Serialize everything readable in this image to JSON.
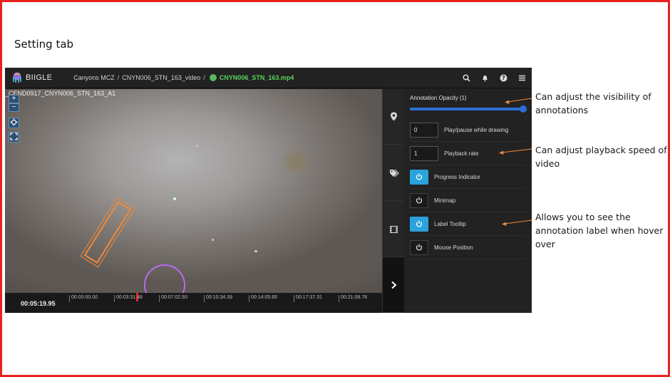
{
  "slide": {
    "heading": "Setting tab",
    "border_color": "#e8231f"
  },
  "navbar": {
    "brand": "BIIGLE",
    "breadcrumb": [
      "Canyons MCZ",
      "CNYN006_STN_163_video"
    ],
    "file_name": "CNYN006_STN_163.mp4",
    "file_status_color": "#5cb85c",
    "icons": [
      "search-icon",
      "bell-icon",
      "help-icon",
      "menu-icon"
    ]
  },
  "video": {
    "label": "_CEND0917_CNYN006_STN_163_A1",
    "map_controls": [
      "+",
      "−"
    ],
    "current_time": "00:05:19.95",
    "timeline_ticks": [
      "00:00:00.00",
      "00:03:31.46",
      "00:07:02.93",
      "00:10:34.39",
      "00:14:05.85",
      "00:17:37.31",
      "00:21:08.78"
    ],
    "annotation_color": "#f08a3c",
    "circle_color": "#b46cf0"
  },
  "toolbar": {
    "groups": [
      [
        "play-icon"
      ],
      [
        "point-icon",
        "polygon-icon",
        "circle-icon",
        "linestring-icon",
        "wholeframe-icon",
        "rectangle-icon"
      ],
      [
        "tag-icon",
        "move-icon",
        "link-icon",
        "unlink-icon",
        "trash-icon"
      ]
    ]
  },
  "sidebar_tabs": [
    "map-marker-icon",
    "tags-icon",
    "film-icon",
    "chevron-right-icon"
  ],
  "settings": {
    "opacity_label": "Annotation Opacity (1)",
    "opacity_value": 1,
    "play_pause_value": "0",
    "play_pause_label": "Play/pause while drawing",
    "playback_rate_value": "1",
    "playback_rate_label": "Playback rate",
    "progress_indicator_label": "Progress Indicator",
    "progress_indicator_on": true,
    "minimap_label": "Minimap",
    "minimap_on": false,
    "label_tooltip_label": "Label Tooltip",
    "label_tooltip_on": true,
    "mouse_position_label": "Mouse Position",
    "mouse_position_on": false,
    "toggle_on_color": "#2aa3dc"
  },
  "callouts": {
    "opacity": "Can adjust the visibility of annotations",
    "playback": "Can adjust playback speed of video",
    "tooltip": "Allows you to see the annotation label when hover over",
    "arrow_color": "#f08a3c"
  }
}
